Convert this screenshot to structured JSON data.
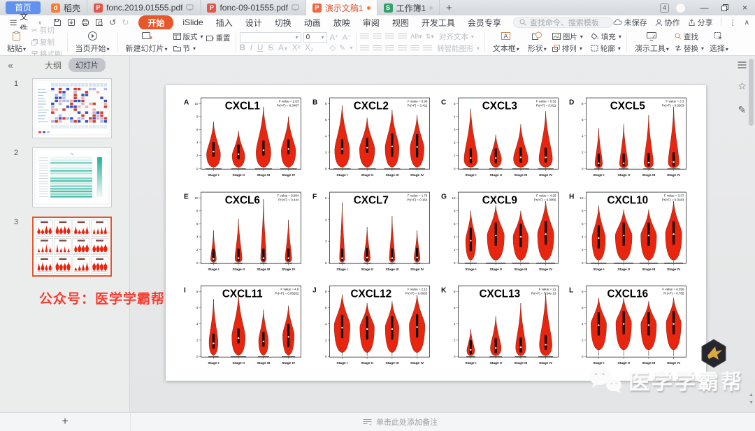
{
  "tabs": {
    "home_label": "首页",
    "items": [
      {
        "label": "稻壳",
        "type": "docer"
      },
      {
        "label": "fonc.2019.01555.pdf",
        "type": "pdf",
        "monitor": true
      },
      {
        "label": "fonc-09-01555.pdf",
        "type": "pdf",
        "monitor": true
      },
      {
        "label": "演示文稿1",
        "type": "ppt",
        "active": true,
        "dot": "#ed7d31"
      },
      {
        "label": "工作簿1",
        "type": "sheet",
        "dot": "#c2c6ca"
      }
    ],
    "new_tab_label": "+",
    "tab_count_badge": "4"
  },
  "window": {
    "minimize": "—",
    "close": "×"
  },
  "menubar": {
    "file_label": "文件",
    "menus": [
      "开始",
      "iSlide",
      "插入",
      "设计",
      "切换",
      "动画",
      "放映",
      "审阅",
      "视图",
      "开发工具",
      "会员专享"
    ],
    "active_menu": "开始",
    "search_placeholder": "查找命令、搜索模板",
    "save_status": "未保存",
    "collab_label": "协作",
    "share_label": "分享"
  },
  "icon_glyphs": {
    "undo": "↺",
    "redo": "↻",
    "cut": "✂",
    "collapse": "«",
    "star": "☆",
    "pen": "✎",
    "more": "⋮",
    "collapse_ribbon": "∧",
    "dropdown": "∨",
    "up_arrow": "▲",
    "down_arrow": "▼"
  },
  "ribbon": {
    "paste": "粘贴",
    "cut": "剪切",
    "copy": "复制",
    "format_painter": "格式刷",
    "play_current": "当页开始",
    "new_slide": "新建幻灯片",
    "layout": "版式",
    "reset": "重置",
    "section": "节",
    "font_name_value": "",
    "font_size_value": "0",
    "font_buttons": [
      "B",
      "I",
      "U",
      "S",
      "A",
      "X²",
      "X₂"
    ],
    "align_text": "对齐文本",
    "to_smart": "转智能图形",
    "text_box": "文本框",
    "shapes": "形状",
    "picture": "图片",
    "fill": "填充",
    "arrange": "排列",
    "outline": "轮廓",
    "present_tools": "演示工具",
    "find": "查找",
    "replace": "替换",
    "select": "选择"
  },
  "sidebar": {
    "outline_tab": "大纲",
    "slides_tab": "幻灯片",
    "slide_numbers": [
      "1",
      "2",
      "3"
    ],
    "selected_index": 2,
    "watermark_text": "公众号：医学学霸帮",
    "add_slide": "+"
  },
  "notes_bar": {
    "placeholder": "单击此处添加备注"
  },
  "footer_watermark": {
    "text": "医学学霸帮"
  },
  "colors": {
    "violin": "#e8250e",
    "accent": "#e8572b",
    "selected_border": "#e8532f"
  },
  "slide": {
    "stages": [
      "Stage I",
      "Stage II",
      "Stage III",
      "Stage IV"
    ],
    "panels": [
      {
        "letter": "A",
        "gene": "CXCL1",
        "f": "F value = 2.63",
        "p": "Pr(>F) = 0.0487",
        "ticks": [
          0,
          2,
          4,
          6,
          8,
          10
        ],
        "base": 0.02,
        "rug": true,
        "violins": [
          {
            "t": 0.72,
            "w": 0.75,
            "b": 0.22,
            "m": 0.26
          },
          {
            "t": 0.58,
            "w": 0.68,
            "b": 0.2,
            "m": 0.22
          },
          {
            "t": 0.95,
            "w": 0.8,
            "b": 0.25,
            "m": 0.28
          },
          {
            "t": 0.8,
            "w": 0.78,
            "b": 0.27,
            "m": 0.3
          }
        ]
      },
      {
        "letter": "B",
        "gene": "CXCL2",
        "f": "F value = 0.96",
        "p": "Pr(>F) = 0.411",
        "ticks": [
          0,
          2,
          4,
          6,
          8
        ],
        "base": 0.02,
        "rug": true,
        "violins": [
          {
            "t": 0.97,
            "w": 0.8,
            "b": 0.28,
            "m": 0.3
          },
          {
            "t": 0.78,
            "w": 0.82,
            "b": 0.3,
            "m": 0.32
          },
          {
            "t": 0.9,
            "w": 0.75,
            "b": 0.32,
            "m": 0.34
          },
          {
            "t": 0.82,
            "w": 0.75,
            "b": 0.32,
            "m": 0.33
          }
        ]
      },
      {
        "letter": "C",
        "gene": "CXCL3",
        "f": "F value = 0.32",
        "p": "Pr(>F) = 0.811",
        "ticks": [
          0,
          1,
          2,
          3,
          4,
          5
        ],
        "base": 0.02,
        "rug": true,
        "violins": [
          {
            "t": 0.92,
            "w": 0.72,
            "b": 0.14,
            "m": 0.16
          },
          {
            "t": 0.52,
            "w": 0.62,
            "b": 0.15,
            "m": 0.16
          },
          {
            "t": 0.68,
            "w": 0.78,
            "b": 0.15,
            "m": 0.17
          },
          {
            "t": 0.88,
            "w": 0.72,
            "b": 0.15,
            "m": 0.17
          }
        ]
      },
      {
        "letter": "D",
        "gene": "CXCL5",
        "f": "F value = 3.3",
        "p": "Pr(>F) = 0.0203",
        "ticks": [
          0,
          2,
          4,
          6,
          8
        ],
        "base": 0.01,
        "rug": true,
        "violins": [
          {
            "t": 0.62,
            "w": 0.4,
            "b": 0.07,
            "m": 0.08
          },
          {
            "t": 0.68,
            "w": 0.44,
            "b": 0.07,
            "m": 0.08
          },
          {
            "t": 0.82,
            "w": 0.5,
            "b": 0.08,
            "m": 0.09
          },
          {
            "t": 0.95,
            "w": 0.58,
            "b": 0.09,
            "m": 0.1
          }
        ]
      },
      {
        "letter": "E",
        "gene": "CXCL6",
        "f": "F value = 0.884",
        "p": "Pr(>F) = 0.444",
        "ticks": [
          0,
          2,
          4,
          6,
          8,
          10
        ],
        "base": 0.01,
        "rug": true,
        "violins": [
          {
            "t": 0.5,
            "w": 0.3,
            "b": 0.05,
            "m": 0.06
          },
          {
            "t": 0.68,
            "w": 0.38,
            "b": 0.06,
            "m": 0.07
          },
          {
            "t": 0.98,
            "w": 0.3,
            "b": 0.06,
            "m": 0.07
          },
          {
            "t": 0.66,
            "w": 0.35,
            "b": 0.06,
            "m": 0.07
          }
        ]
      },
      {
        "letter": "F",
        "gene": "CXCL7",
        "f": "F value = 1.76",
        "p": "Pr(>F) = 0.154",
        "ticks": [
          0,
          2,
          4,
          6
        ],
        "base": 0.01,
        "rug": true,
        "violins": [
          {
            "t": 0.93,
            "w": 0.28,
            "b": 0.06,
            "m": 0.07
          },
          {
            "t": 0.55,
            "w": 0.34,
            "b": 0.07,
            "m": 0.08
          },
          {
            "t": 0.72,
            "w": 0.3,
            "b": 0.06,
            "m": 0.07
          },
          {
            "t": 0.5,
            "w": 0.32,
            "b": 0.07,
            "m": 0.08
          }
        ]
      },
      {
        "letter": "G",
        "gene": "CXCL9",
        "f": "F value = 4.25",
        "p": "Pr(>F) = 0.0056",
        "ticks": [
          0,
          2,
          4,
          6,
          8,
          10
        ],
        "base": 0.04,
        "rug": true,
        "violins": [
          {
            "t": 0.8,
            "w": 0.55,
            "b": 0.35,
            "m": 0.34
          },
          {
            "t": 0.88,
            "w": 0.92,
            "b": 0.42,
            "m": 0.42
          },
          {
            "t": 0.8,
            "w": 0.82,
            "b": 0.4,
            "m": 0.4
          },
          {
            "t": 0.95,
            "w": 0.88,
            "b": 0.44,
            "m": 0.44
          }
        ]
      },
      {
        "letter": "H",
        "gene": "CXCL10",
        "f": "F value = 3.37",
        "p": "Pr(>F) = 0.0183",
        "ticks": [
          0,
          2,
          4,
          6,
          8,
          10
        ],
        "base": 0.04,
        "rug": true,
        "violins": [
          {
            "t": 0.88,
            "w": 0.72,
            "b": 0.38,
            "m": 0.38
          },
          {
            "t": 0.82,
            "w": 0.9,
            "b": 0.42,
            "m": 0.42
          },
          {
            "t": 0.82,
            "w": 0.85,
            "b": 0.42,
            "m": 0.42
          },
          {
            "t": 0.95,
            "w": 0.88,
            "b": 0.45,
            "m": 0.44
          }
        ]
      },
      {
        "letter": "I",
        "gene": "CXCL11",
        "f": "F value = 4.8",
        "p": "Pr(>F) = 0.00262",
        "ticks": [
          0,
          2,
          4,
          6,
          8
        ],
        "base": 0.02,
        "rug": true,
        "violins": [
          {
            "t": 0.88,
            "w": 0.48,
            "b": 0.22,
            "m": 0.2
          },
          {
            "t": 0.95,
            "w": 0.72,
            "b": 0.3,
            "m": 0.28
          },
          {
            "t": 0.72,
            "w": 0.52,
            "b": 0.24,
            "m": 0.23
          },
          {
            "t": 0.78,
            "w": 0.62,
            "b": 0.33,
            "m": 0.3
          }
        ]
      },
      {
        "letter": "J",
        "gene": "CXCL12",
        "f": "F value = 2.12",
        "p": "Pr(>F) = 0.0963",
        "ticks": [
          0,
          2,
          4,
          6,
          8
        ],
        "base": 0.06,
        "rug": false,
        "violins": [
          {
            "t": 0.95,
            "w": 0.85,
            "b": 0.48,
            "m": 0.44
          },
          {
            "t": 0.82,
            "w": 0.78,
            "b": 0.45,
            "m": 0.42
          },
          {
            "t": 0.85,
            "w": 0.74,
            "b": 0.45,
            "m": 0.42
          },
          {
            "t": 0.95,
            "w": 0.84,
            "b": 0.48,
            "m": 0.45
          }
        ]
      },
      {
        "letter": "K",
        "gene": "CXCL13",
        "f": "F value = 21",
        "p": "Pr(>F) = 7.54e-13",
        "ticks": [
          0,
          2,
          4,
          6,
          8
        ],
        "base": 0.01,
        "rug": true,
        "violins": [
          {
            "t": 0.42,
            "w": 0.42,
            "b": 0.09,
            "m": 0.1
          },
          {
            "t": 0.62,
            "w": 0.58,
            "b": 0.13,
            "m": 0.13
          },
          {
            "t": 0.82,
            "w": 0.54,
            "b": 0.14,
            "m": 0.14
          },
          {
            "t": 0.98,
            "w": 0.68,
            "b": 0.18,
            "m": 0.18
          }
        ]
      },
      {
        "letter": "L",
        "gene": "CXCL16",
        "f": "F value = 0.356",
        "p": "Pr(>F) = 0.785",
        "ticks": [
          0,
          2,
          4,
          6,
          8
        ],
        "base": 0.1,
        "rug": false,
        "violins": [
          {
            "t": 0.9,
            "w": 0.84,
            "b": 0.5,
            "m": 0.48
          },
          {
            "t": 0.9,
            "w": 0.84,
            "b": 0.52,
            "m": 0.5
          },
          {
            "t": 0.85,
            "w": 0.84,
            "b": 0.5,
            "m": 0.48
          },
          {
            "t": 0.9,
            "w": 0.8,
            "b": 0.52,
            "m": 0.5
          }
        ]
      }
    ]
  }
}
